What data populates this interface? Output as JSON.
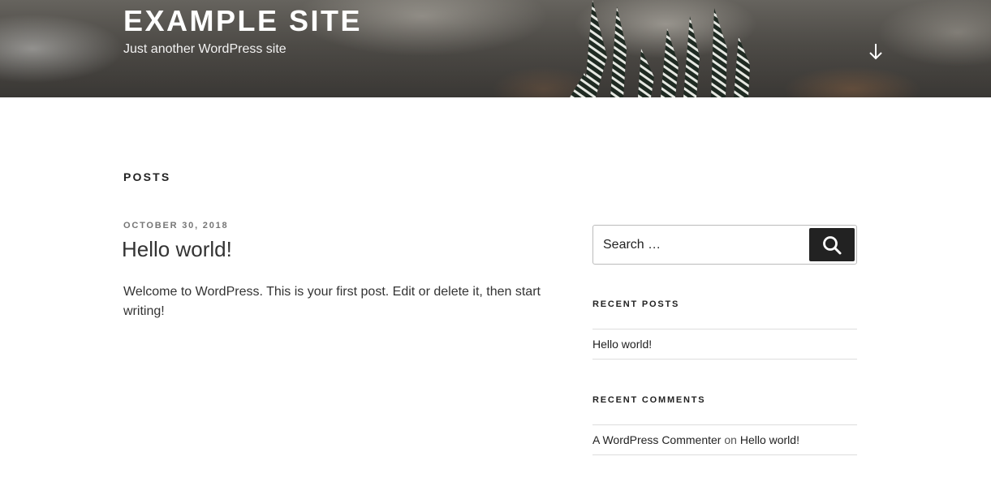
{
  "header": {
    "site_title": "EXAMPLE SITE",
    "tagline": "Just another WordPress site",
    "scroll_icon": "arrow-down-icon"
  },
  "main": {
    "page_title": "POSTS",
    "post": {
      "date": "OCTOBER 30, 2018",
      "title": "Hello world!",
      "excerpt": "Welcome to WordPress. This is your first post. Edit or delete it, then start writing!"
    }
  },
  "sidebar": {
    "search": {
      "placeholder": "Search …",
      "button_icon": "search-icon"
    },
    "recent_posts": {
      "title": "RECENT POSTS",
      "items": [
        {
          "label": "Hello world!"
        }
      ]
    },
    "recent_comments": {
      "title": "RECENT COMMENTS",
      "items": [
        {
          "author": "A WordPress Commenter",
          "on": "on",
          "post": "Hello world!"
        }
      ]
    }
  },
  "colors": {
    "text": "#222222",
    "meta": "#767676",
    "button_bg": "#222222",
    "border": "#dddddd"
  }
}
